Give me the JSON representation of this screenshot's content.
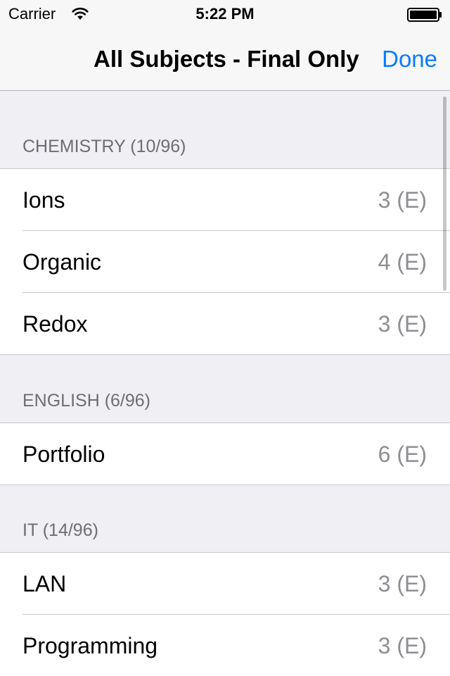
{
  "status_bar": {
    "carrier": "Carrier",
    "time": "5:22 PM",
    "wifi_icon": "wifi-icon",
    "battery_icon": "battery-icon"
  },
  "nav_bar": {
    "title": "All Subjects - Final Only",
    "done_label": "Done",
    "accent_color": "#0a7aff"
  },
  "sections": [
    {
      "header": "CHEMISTRY (10/96)",
      "rows": [
        {
          "label": "Ions",
          "value": "3 (E)"
        },
        {
          "label": "Organic",
          "value": "4 (E)"
        },
        {
          "label": "Redox",
          "value": "3 (E)"
        }
      ]
    },
    {
      "header": "ENGLISH (6/96)",
      "rows": [
        {
          "label": "Portfolio",
          "value": "6 (E)"
        }
      ]
    },
    {
      "header": "IT (14/96)",
      "rows": [
        {
          "label": "LAN",
          "value": "3 (E)"
        },
        {
          "label": "Programming",
          "value": "3 (E)"
        }
      ]
    }
  ]
}
